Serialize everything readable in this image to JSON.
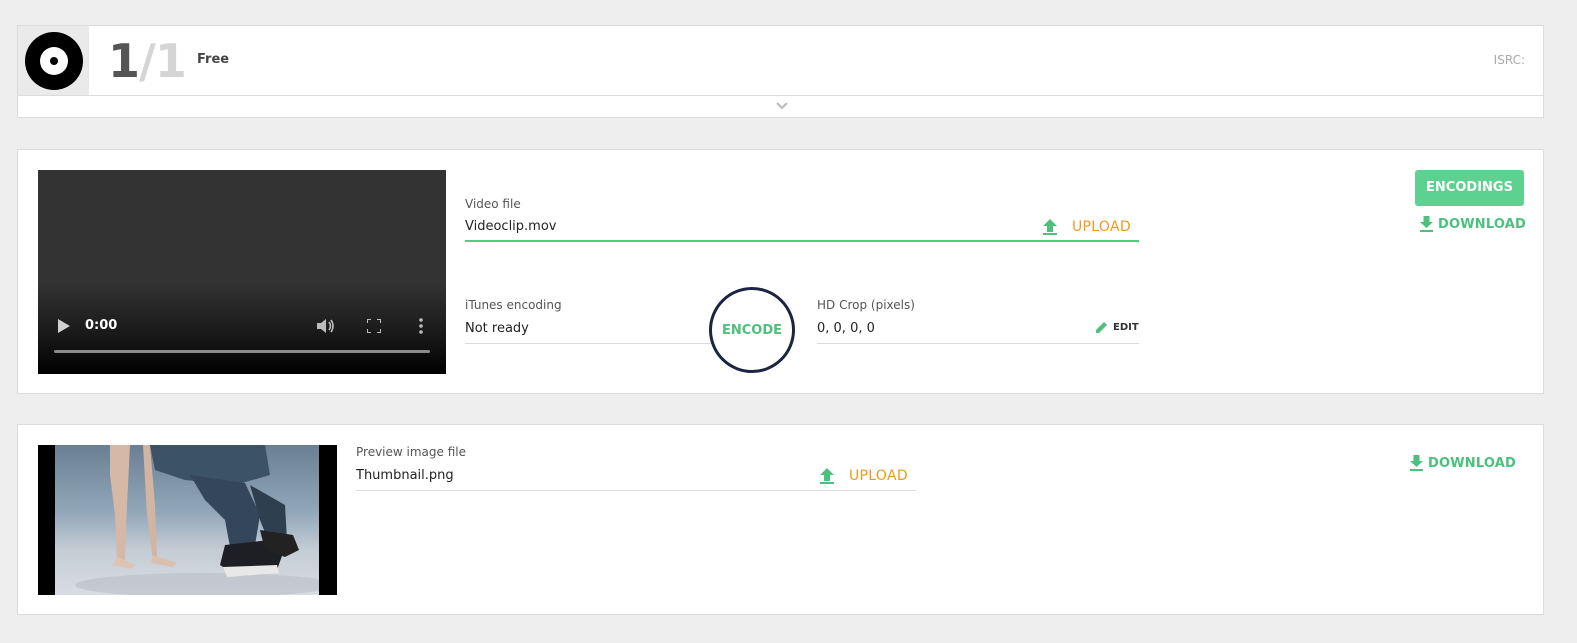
{
  "track": {
    "number": "1",
    "separator": "/",
    "total": "1",
    "title": "Free",
    "isrc_label": "ISRC:"
  },
  "video": {
    "player_time": "0:00",
    "file_label": "Video file",
    "file_value": "Videoclip.mov",
    "upload_label": "UPLOAD",
    "encodings_label": "ENCODINGS",
    "download_label": "DOWNLOAD",
    "itunes_label": "iTunes encoding",
    "itunes_value": "Not ready",
    "encode_label": "ENCODE",
    "crop_label": "HD Crop (pixels)",
    "crop_value": "0, 0, 0, 0",
    "edit_label": "EDIT"
  },
  "preview": {
    "file_label": "Preview image file",
    "file_value": "Thumbnail.png",
    "upload_label": "UPLOAD",
    "download_label": "DOWNLOAD"
  },
  "colors": {
    "accent_green": "#5dd18f",
    "upload_orange": "#f09a1a",
    "encode_ring": "#1b2440"
  }
}
